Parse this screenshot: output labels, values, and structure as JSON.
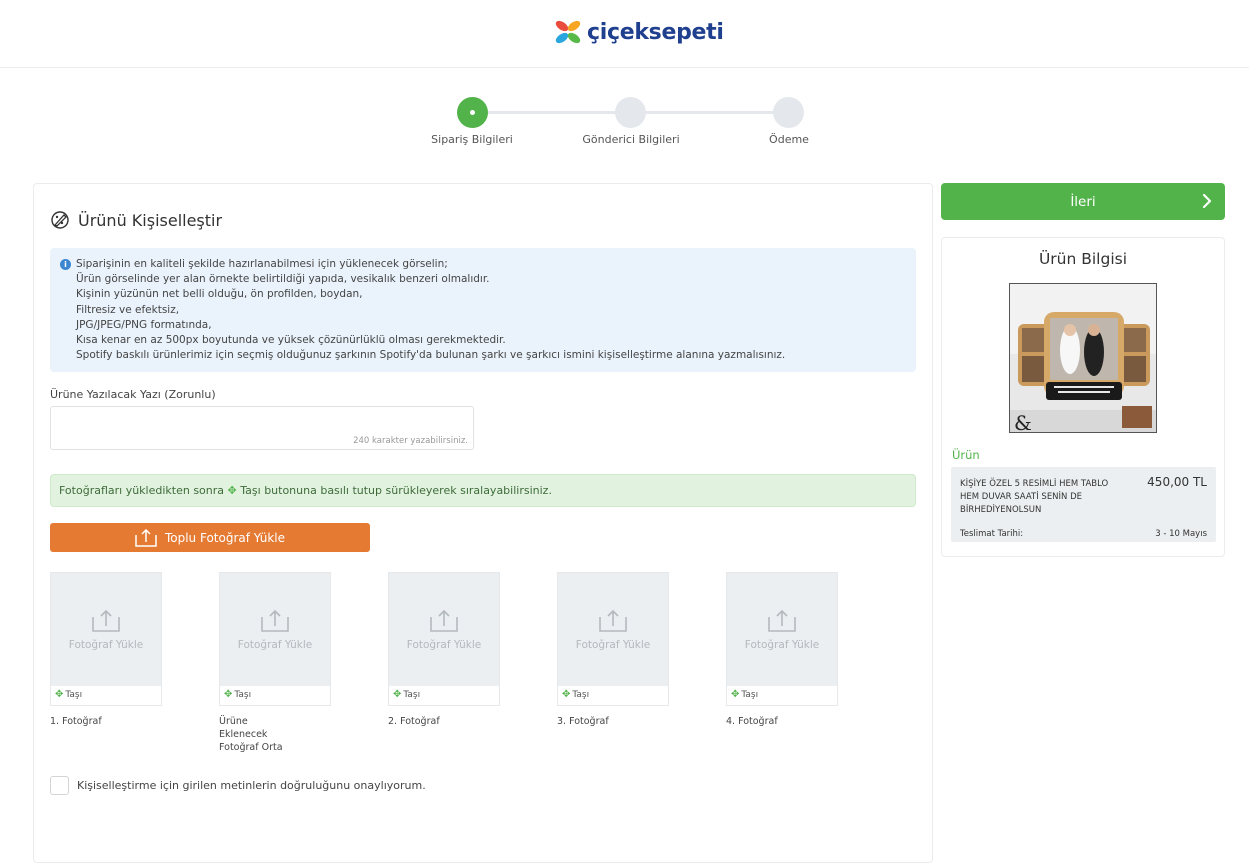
{
  "header": {
    "logo_text": "çiçeksepeti"
  },
  "steps": [
    {
      "label": "Sipariş Bilgileri",
      "active": true
    },
    {
      "label": "Gönderici Bilgileri",
      "active": false
    },
    {
      "label": "Ödeme",
      "active": false
    }
  ],
  "main": {
    "title": "Ürünü Kişiselleştir",
    "info_lines": [
      "Siparişinin en kaliteli şekilde hazırlanabilmesi için yüklenecek görselin;",
      "Ürün görselinde yer alan örnekte belirtildiği yapıda, vesikalık benzeri olmalıdır.",
      "Kişinin yüzünün net belli olduğu, ön profilden, boydan,",
      "Filtresiz ve efektsiz,",
      "JPG/JPEG/PNG formatında,",
      "Kısa kenar en az 500px boyutunda ve yüksek çözünürlüklü olması gerekmektedir.",
      "Spotify baskılı ürünlerimiz için seçmiş olduğunuz şarkının Spotify'da bulunan şarkı ve şarkıcı ismini kişiselleştirme alanına yazmalısınız."
    ],
    "text_field": {
      "label": "Ürüne Yazılacak Yazı (Zorunlu)",
      "value": "",
      "counter": "240 karakter yazabilirsiniz."
    },
    "sort_hint": {
      "before": "Fotoğrafları yükledikten sonra",
      "move_word": "Taşı",
      "after": "butonuna basılı tutup sürükleyerek sıralayabilirsiniz."
    },
    "bulk_upload_label": "Toplu Fotoğraf Yükle",
    "photo_slots": [
      {
        "upload_label": "Fotoğraf Yükle",
        "move_label": "Taşı",
        "caption": "1. Fotoğraf"
      },
      {
        "upload_label": "Fotoğraf Yükle",
        "move_label": "Taşı",
        "caption": "Ürüne Eklenecek Fotoğraf Orta"
      },
      {
        "upload_label": "Fotoğraf Yükle",
        "move_label": "Taşı",
        "caption": "2. Fotoğraf"
      },
      {
        "upload_label": "Fotoğraf Yükle",
        "move_label": "Taşı",
        "caption": "3. Fotoğraf"
      },
      {
        "upload_label": "Fotoğraf Yükle",
        "move_label": "Taşı",
        "caption": "4. Fotoğraf"
      }
    ],
    "confirm_label": "Kişiselleştirme için girilen metinlerin doğruluğunu onaylıyorum.",
    "confirm_checked": false
  },
  "sidebar": {
    "next_button": "İleri",
    "title": "Ürün Bilgisi",
    "product_section_label": "Ürün",
    "product_name": "KİŞİYE ÖZEL 5 RESİMLİ HEM TABLO HEM DUVAR SAATİ SENİN DE BİRHEDİYENOLSUN",
    "price": "450,00 TL",
    "delivery_label": "Teslimat Tarihi:",
    "delivery_value": "3 - 10 Mayıs"
  },
  "colors": {
    "primary_green": "#52b34a",
    "upload_orange": "#e57a33",
    "info_bg": "#eaf3fc",
    "hint_bg": "#e1f3df",
    "brand_blue": "#1f3f8f"
  },
  "icons": {
    "title_icon": "brush-icon",
    "info_icon": "info-icon",
    "upload_icon": "upload-icon",
    "move_icon": "move-icon",
    "next_icon": "chevron-right-icon"
  }
}
